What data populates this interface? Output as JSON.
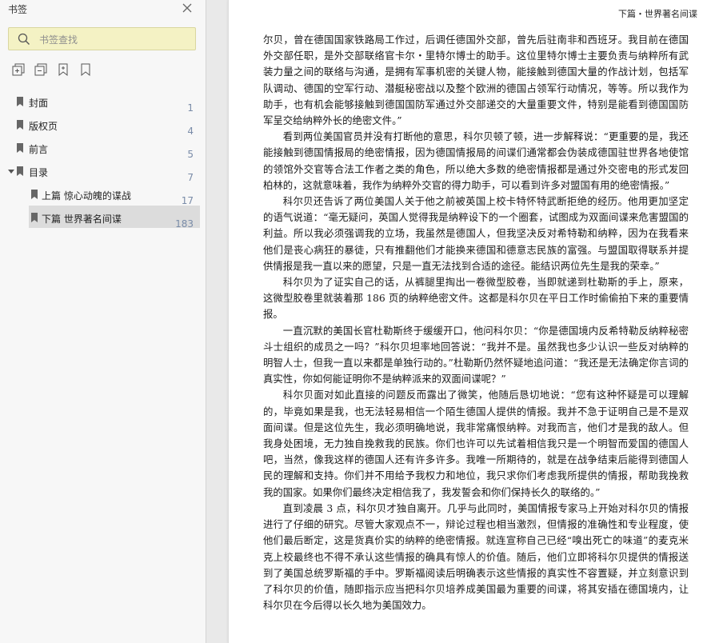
{
  "sidebar": {
    "title": "书签",
    "search_placeholder": "书签查找",
    "toolbar": [
      {
        "icon": "expand-bookmarks-icon"
      },
      {
        "icon": "collapse-bookmarks-icon"
      },
      {
        "icon": "add-bookmark-icon"
      },
      {
        "icon": "bookmark-icon"
      }
    ],
    "items": [
      {
        "label": "封面",
        "page": "1"
      },
      {
        "label": "版权页",
        "page": "4"
      },
      {
        "label": "前言",
        "page": "5"
      },
      {
        "label": "目录",
        "page": "7"
      },
      {
        "label": "上篇 惊心动魄的谍战",
        "page": "17"
      },
      {
        "label": "下篇 世界著名间谍",
        "page": "183"
      }
    ]
  },
  "page": {
    "running_head": "下篇・世界著名间谍",
    "paragraphs": [
      "尔贝，曾在德国国家铁路局工作过，后调任德国外交部，曾先后驻南非和西班牙。我目前在德国外交部任职，是外交部联络官卡尔・里特尔博士的助手。这位里特尔博士主要负责与纳粹所有武装力量之间的联络与沟通，是拥有军事机密的关键人物，能接触到德国大量的作战计划，包括军队调动、德国的空军行动、潜艇秘密战以及整个欧洲的德国占领军行动情况，等等。所以我作为助手，也有机会能够接触到德国国防军通过外交部递交的大量重要文件，特别是能看到德国国防军呈交给纳粹外长的绝密文件。”",
      "看到两位美国官员并没有打断他的意思，科尔贝顿了顿，进一步解释说：“更重要的是，我还能接触到德国情报局的绝密情报，因为德国情报局的间谍们通常都会伪装成德国驻世界各地使馆的领馆外交官等合法工作者之类的角色，所以绝大多数的绝密情报都是通过外交密电的形式发回柏林的，这就意味着，我作为纳粹外交官的得力助手，可以看到许多对盟国有用的绝密情报。”",
      "科尔贝还告诉了两位美国人关于他之前被英国上校卡特怀特武断拒绝的经历。他用更加坚定的语气说道：“毫无疑问，英国人觉得我是纳粹设下的一个圈套，试图成为双面间谍来危害盟国的利益。所以我必须强调我的立场，我虽然是德国人，但我坚决反对希特勒和纳粹，因为在我看来他们是丧心病狂的暴徒，只有推翻他们才能换来德国和德意志民族的富强。与盟国取得联系并提供情报是我一直以来的愿望，只是一直无法找到合适的途径。能结识两位先生是我的荣幸。”",
      "科尔贝为了证实自己的话，从裤腿里掏出一卷微型胶卷，当即就递到杜勒斯的手上，原来，这微型胶卷里就装着那 186 页的纳粹绝密文件。这都是科尔贝在平日工作时偷偷拍下来的重要情报。",
      "一直沉默的美国长官杜勒斯终于缓缓开口，他问科尔贝：“你是德国境内反希特勒反纳粹秘密斗士组织的成员之一吗？”科尔贝坦率地回答说：“我并不是。虽然我也多少认识一些反对纳粹的明智人士，但我一直以来都是单独行动的。”杜勒斯仍然怀疑地追问道：“我还是无法确定你言词的真实性，你如何能证明你不是纳粹派来的双面间谍呢？”",
      "科尔贝面对如此直接的问题反而露出了微笑，他随后恳切地说：“您有这种怀疑是可以理解的，毕竟如果是我，也无法轻易相信一个陌生德国人提供的情报。我并不急于证明自己是不是双面间谍。但是这位先生，我必须明确地说，我非常痛恨纳粹。对我而言，他们才是我的敌人。但我身处困境，无力独自挽救我的民族。你们也许可以先试着相信我只是一个明智而爱国的德国人吧，当然，像我这样的德国人还有许多许多。我唯一所期待的，就是在战争结束后能得到德国人民的理解和支持。你们并不用给予我权力和地位，我只求你们考虑我所提供的情报，帮助我挽救我的国家。如果你们最终决定相信我了，我发誓会和你们保持长久的联络的。”",
      "直到凌晨 3 点，科尔贝才独自离开。几乎与此同时，美国情报专家马上开始对科尔贝的情报进行了仔细的研究。尽管大家观点不一，辩论过程也相当激烈，但情报的准确性和专业程度，使他们最后断定，这是货真价实的纳粹的绝密情报。就连宣称自己已经“嗅出死亡的味道”的麦克米克上校最终也不得不承认这些情报的确具有惊人的价值。随后，他们立即将科尔贝提供的情报送到了美国总统罗斯福的手中。罗斯福阅读后明确表示这些情报的真实性不容置疑，并立刻意识到了科尔贝的价值，随即指示应当把科尔贝培养成美国最为重要的间谍，将其安插在德国境内，让科尔贝在今后得以长久地为美国效力。"
    ]
  },
  "colors": {
    "search_bg": "#f4f2c4",
    "active_item_bg": "#dcdcdc",
    "page_number": "#7a8ca8"
  }
}
